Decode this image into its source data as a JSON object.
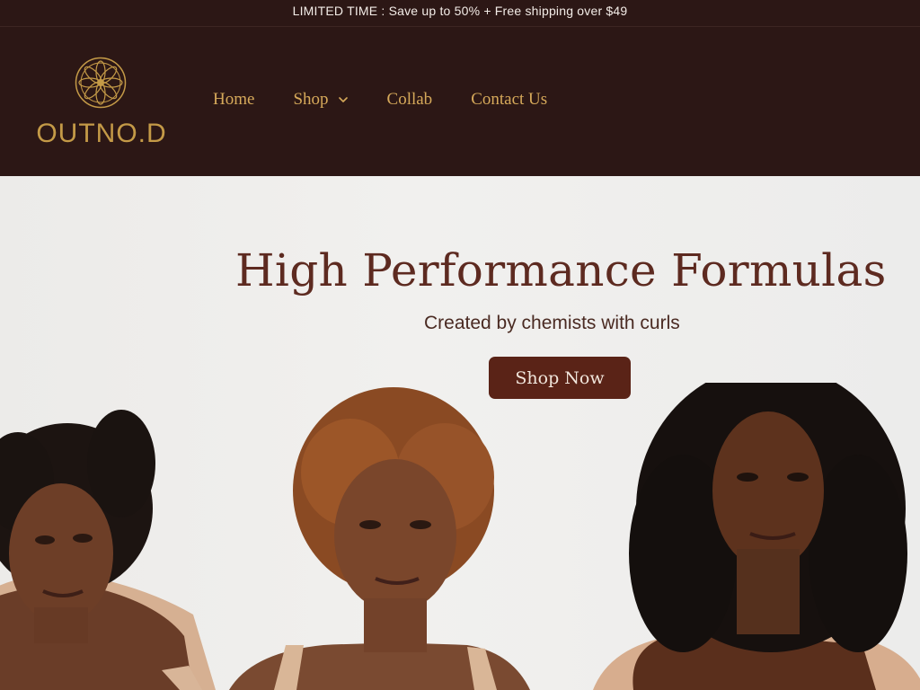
{
  "announcement": {
    "text": "LIMITED TIME : Save up to 50% + Free shipping over $49"
  },
  "header": {
    "logo_text": "OUTNO.D",
    "nav": [
      {
        "label": "Home"
      },
      {
        "label": "Shop"
      },
      {
        "label": "Collab"
      },
      {
        "label": "Contact Us"
      }
    ]
  },
  "hero": {
    "title": "High Performance Formulas",
    "subtitle": "Created by chemists with curls",
    "cta_label": "Shop Now"
  },
  "icons": {
    "logo_mark": "mandala-icon",
    "shop_dropdown": "chevron-down-icon"
  },
  "colors": {
    "header_background": "#2c1715",
    "nav_text": "#d6a95a",
    "logo_gold": "#c49a47",
    "hero_background": "#efeeec",
    "hero_title": "#5d2a20",
    "cta_background": "#5a2317"
  }
}
